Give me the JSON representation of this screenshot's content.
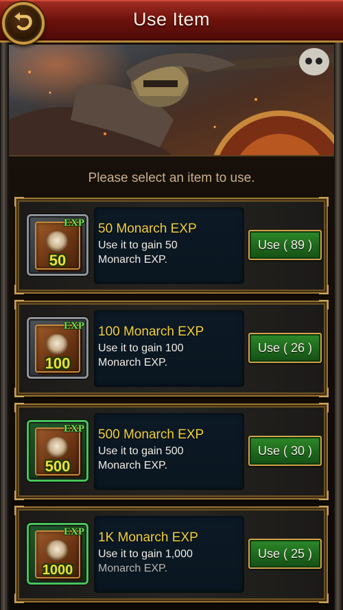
{
  "window": {
    "title": "Use Item"
  },
  "prompt": "Please select an item to use.",
  "items": [
    {
      "name": "50 Monarch EXP",
      "desc_line1": "Use it to gain 50",
      "desc_line2": "Monarch EXP.",
      "icon_label": "EXP",
      "icon_amount": "50",
      "icon": "exp-book-icon",
      "tier": "gray",
      "button": "Use ( 89 )"
    },
    {
      "name": "100 Monarch EXP",
      "desc_line1": "Use it to gain 100",
      "desc_line2": "Monarch EXP.",
      "icon_label": "EXP",
      "icon_amount": "100",
      "icon": "exp-book-icon",
      "tier": "gray",
      "button": "Use ( 26 )"
    },
    {
      "name": "500 Monarch EXP",
      "desc_line1": "Use it to gain 500",
      "desc_line2": "Monarch EXP.",
      "icon_label": "EXP",
      "icon_amount": "500",
      "icon": "exp-book-icon",
      "tier": "green",
      "button": "Use ( 30 )"
    },
    {
      "name": "1K Monarch EXP",
      "desc_line1": "Use it to gain 1,000",
      "desc_line2": "Monarch EXP.",
      "icon_label": "EXP",
      "icon_amount": "1000",
      "icon": "exp-book-icon",
      "tier": "green",
      "button": "Use ( 25 )"
    }
  ],
  "colors": {
    "title_bar": "#7a140e",
    "item_name": "#f3d13c",
    "use_button": "#1e6a1c",
    "frame_gold": "#9b7434",
    "prompt_text": "#c8b08a"
  }
}
